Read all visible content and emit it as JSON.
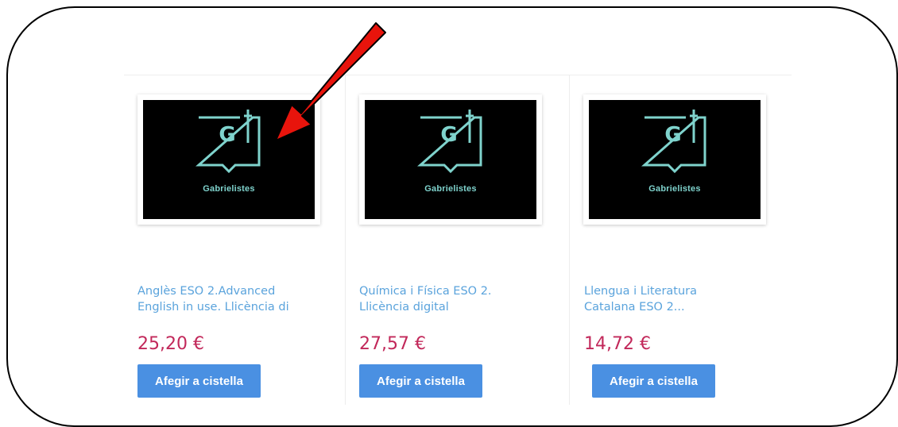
{
  "products": [
    {
      "title_line1": "Anglès ESO 2.Advanced",
      "title_line2": "English in use. Llicència di",
      "price": "25,20 €",
      "button_label": "Afegir a cistella",
      "image_caption": "Gabrielistes",
      "logo_letter": "G"
    },
    {
      "title_line1": "Química i Física ESO 2.",
      "title_line2": "Llicència digital",
      "price": "27,57 €",
      "button_label": "Afegir a cistella",
      "image_caption": "Gabrielistes",
      "logo_letter": "G"
    },
    {
      "title_line1": "Llengua i Literatura",
      "title_line2": "Catalana ESO 2...",
      "price": "14,72 €",
      "button_label": "Afegir a cistella",
      "image_caption": "Gabrielistes",
      "logo_letter": "G"
    }
  ],
  "annotation": {
    "icon": "red-arrow-icon",
    "color": "#e8140c"
  },
  "colors": {
    "logo": "#7fd3cd",
    "title_link": "#5aa3dc",
    "price": "#c2285a",
    "button": "#4a90e2"
  }
}
